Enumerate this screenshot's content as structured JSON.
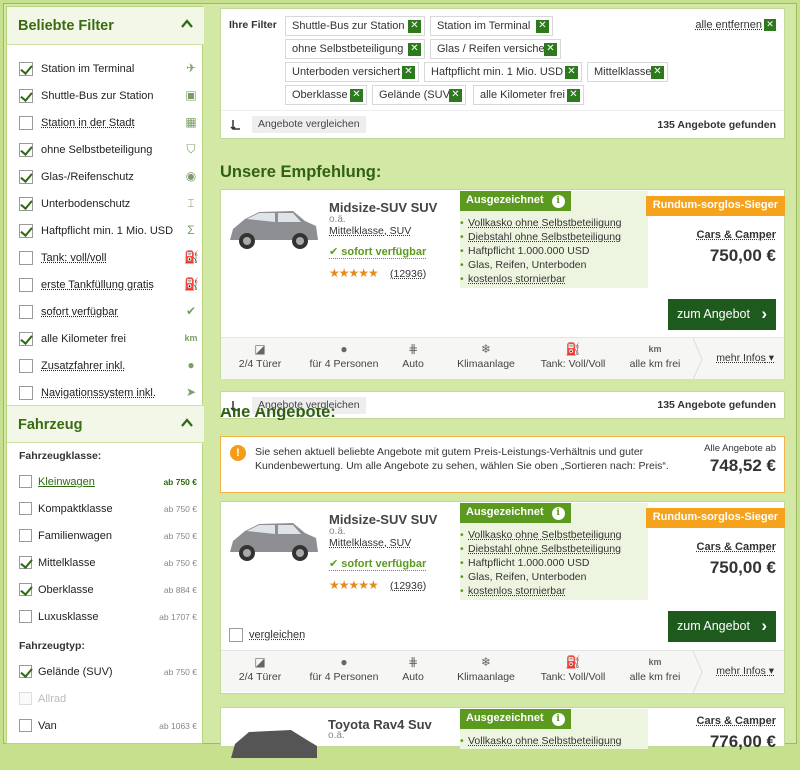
{
  "sidebar": {
    "filters_title": "Beliebte Filter",
    "filters": [
      {
        "label": "Station im Terminal",
        "checked": true,
        "icon": "plane-icon"
      },
      {
        "label": "Shuttle-Bus zur Station",
        "checked": true,
        "icon": "bus-icon"
      },
      {
        "label": "Station in der Stadt",
        "checked": false,
        "icon": "building-icon"
      },
      {
        "label": "ohne Selbstbeteiligung",
        "checked": true,
        "icon": "shield-icon"
      },
      {
        "label": "Glas-/Reifenschutz",
        "checked": true,
        "icon": "eye-icon"
      },
      {
        "label": "Unterbodenschutz",
        "checked": true,
        "icon": "car-lift-icon"
      },
      {
        "label": "Haftpflicht min. 1 Mio. USD",
        "checked": true,
        "icon": "sigma-icon"
      },
      {
        "label": "Tank: voll/voll",
        "checked": false,
        "icon": "fuel-icon"
      },
      {
        "label": "erste Tankfüllung gratis",
        "checked": false,
        "icon": "fuel-icon"
      },
      {
        "label": "sofort verfügbar",
        "checked": false,
        "icon": "check-icon"
      },
      {
        "label": "alle Kilometer frei",
        "checked": true,
        "icon": "km-icon"
      },
      {
        "label": "Zusatzfahrer inkl.",
        "checked": false,
        "icon": "person-icon"
      },
      {
        "label": "Navigationssystem inkl.",
        "checked": false,
        "icon": "navigation-icon"
      }
    ],
    "vehicle_title": "Fahrzeug",
    "class_label": "Fahrzeugklasse:",
    "classes": [
      {
        "label": "Kleinwagen",
        "price": "ab 750 €",
        "checked": false,
        "link": true
      },
      {
        "label": "Kompaktklasse",
        "price": "ab 750 €",
        "checked": false
      },
      {
        "label": "Familienwagen",
        "price": "ab 750 €",
        "checked": false
      },
      {
        "label": "Mittelklasse",
        "price": "ab 750 €",
        "checked": true
      },
      {
        "label": "Oberklasse",
        "price": "ab 884 €",
        "checked": true
      },
      {
        "label": "Luxusklasse",
        "price": "ab 1707 €",
        "checked": false
      }
    ],
    "type_label": "Fahrzeugtyp:",
    "types": [
      {
        "label": "Gelände (SUV)",
        "price": "ab 750 €",
        "checked": true,
        "disabled": false
      },
      {
        "label": "Allrad",
        "price": "",
        "checked": false,
        "disabled": true
      },
      {
        "label": "Van",
        "price": "ab 1063 €",
        "checked": false,
        "disabled": false
      }
    ]
  },
  "filters_panel": {
    "label": "Ihre Filter",
    "chips": [
      "Shuttle-Bus zur Station",
      "Station im Terminal",
      "ohne Selbstbeteiligung",
      "Glas / Reifen versichert",
      "Unterboden versichert",
      "Haftpflicht min. 1 Mio. USD",
      "Mittelklasse",
      "Oberklasse",
      "Gelände (SUV)",
      "alle Kilometer frei"
    ],
    "remove_all": "alle entfernen",
    "compare": "Angebote vergleichen",
    "found": "135 Angebote gefunden"
  },
  "recommend_title": "Unsere Empfehlung:",
  "all_offers_title": "Alle Angebote:",
  "info": {
    "text": "Sie sehen aktuell beliebte Angebote mit gutem Preis-Leistungs-Verhältnis und guter Kundenbewertung. Um alle Angebote zu sehen, wählen Sie oben „Sortieren nach: Preis“.",
    "all_label": "Alle Angebote ab",
    "all_price": "748,52 €"
  },
  "offer": {
    "title": "Midsize-SUV SUV",
    "oa": "o.ä.",
    "class": "Mittelklasse, SUV",
    "available": "sofort verfügbar",
    "stars": "★★★★★",
    "rating": 4.5,
    "reviews": "(12936)",
    "badge": "Ausgezeichnet",
    "includes": [
      "Vollkasko ohne Selbstbeteiligung",
      "Diebstahl ohne Selbstbeteiligung",
      "Haftpflicht 1.000.000 USD",
      "Glas, Reifen, Unterboden",
      "kostenlos stornierbar"
    ],
    "sieger": "Rundum-sorglos-Sieger",
    "vendor": "Cars & Camper",
    "price": "750,00 €",
    "button": "zum Angebot",
    "compare": "vergleichen",
    "features": [
      {
        "icon": "door-icon",
        "label": "2/4 Türer"
      },
      {
        "icon": "person-icon",
        "label": "für 4 Personen"
      },
      {
        "icon": "gearshift-icon",
        "label": "Auto"
      },
      {
        "icon": "snowflake-icon",
        "label": "Klimaanlage"
      },
      {
        "icon": "fuel-icon",
        "label": "Tank: Voll/Voll"
      },
      {
        "icon": "km-icon",
        "label": "alle km frei"
      }
    ],
    "more": "mehr Infos"
  },
  "offer3": {
    "title": "Toyota Rav4 Suv",
    "oa": "o.ä.",
    "badge": "Ausgezeichnet",
    "include_first": "Vollkasko ohne Selbstbeteiligung",
    "vendor": "Cars & Camper",
    "price": "776,00 €"
  },
  "colors": {
    "brand_green": "#2f6210",
    "badge_green": "#5c9a1f",
    "orange": "#f5a21c",
    "button_green": "#1e5a1e"
  }
}
